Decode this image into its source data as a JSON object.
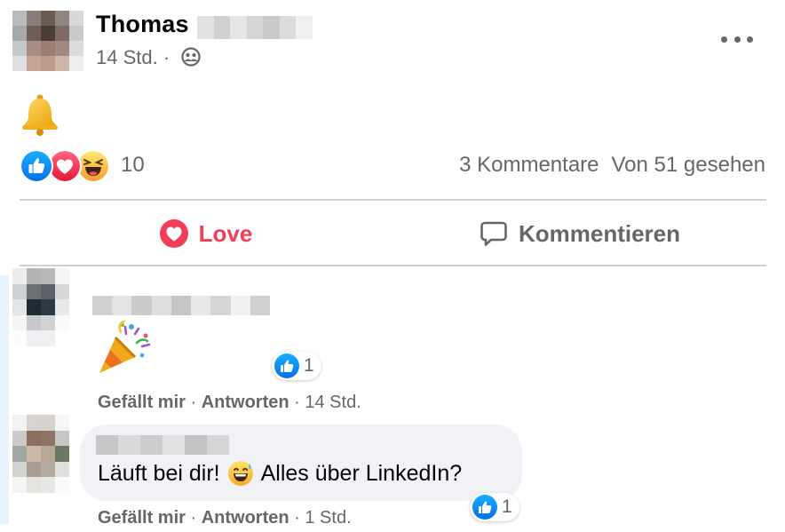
{
  "post": {
    "author_first_name": "Thomas",
    "time": "14 Std. ·",
    "reactions_count": "10",
    "comments_count": "3 Kommentare",
    "seen_by": "Von 51 gesehen"
  },
  "actions": {
    "love_label": "Love",
    "comment_label": "Kommentieren"
  },
  "comments": [
    {
      "reaction_count": "1",
      "like_label": "Gefällt mir",
      "reply_label": "Antworten",
      "time": "14 Std."
    },
    {
      "text_before": "Läuft bei dir!",
      "text_after": "Alles über LinkedIn?",
      "reaction_count": "1",
      "like_label": "Gefällt mir",
      "reply_label": "Antworten",
      "time": "1 Std."
    }
  ],
  "icons": [
    "globe-people-icon",
    "more-options-icon",
    "bell-emoji",
    "like-reaction-icon",
    "love-reaction-icon",
    "haha-reaction-icon",
    "heart-icon",
    "comment-icon",
    "party-popper-emoji",
    "grinning-sweat-emoji"
  ],
  "colors": {
    "love": "#f33e58",
    "like_blue": "#0770e8",
    "secondary_text": "#65676b",
    "divider": "#ced0d4",
    "bubble": "#f0f2f5"
  }
}
